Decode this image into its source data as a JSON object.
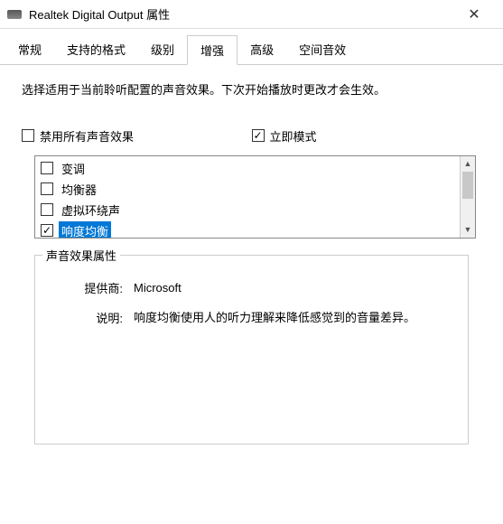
{
  "titlebar": {
    "title": "Realtek Digital Output 属性",
    "close": "✕"
  },
  "tabs": [
    {
      "id": "general",
      "label": "常规"
    },
    {
      "id": "formats",
      "label": "支持的格式"
    },
    {
      "id": "levels",
      "label": "级别"
    },
    {
      "id": "enhance",
      "label": "增强"
    },
    {
      "id": "advanced",
      "label": "高级"
    },
    {
      "id": "spatial",
      "label": "空间音效"
    }
  ],
  "active_tab": "enhance",
  "intro": "选择适用于当前聆听配置的声音效果。下次开始播放时更改才会生效。",
  "disable_all": {
    "label": "禁用所有声音效果",
    "checked": false
  },
  "immediate_mode": {
    "label": "立即模式",
    "checked": true
  },
  "effects": [
    {
      "label": "变调",
      "checked": false,
      "selected": false
    },
    {
      "label": "均衡器",
      "checked": false,
      "selected": false
    },
    {
      "label": "虚拟环绕声",
      "checked": false,
      "selected": false
    },
    {
      "label": "响度均衡",
      "checked": true,
      "selected": true
    }
  ],
  "group": {
    "title": "声音效果属性",
    "provider_label": "提供商:",
    "provider": "Microsoft",
    "desc_label": "说明:",
    "desc": "响度均衡使用人的听力理解来降低感觉到的音量差异。"
  }
}
